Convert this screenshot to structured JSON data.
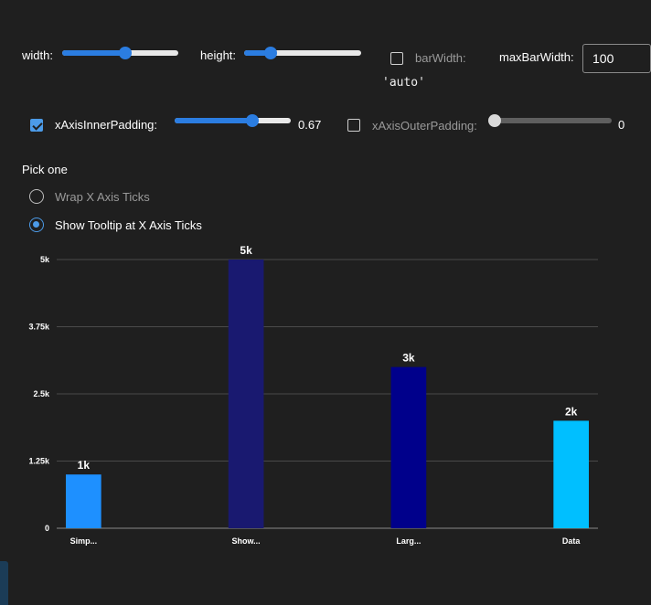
{
  "controls": {
    "width": {
      "label": "width:",
      "fraction": 0.54
    },
    "height": {
      "label": "height:",
      "fraction": 0.23
    },
    "bar_width": {
      "label": "barWidth:",
      "checked": false,
      "value_text": "'auto'"
    },
    "max_bar_width": {
      "label": "maxBarWidth:",
      "value": "100"
    },
    "x_axis_inner_padding": {
      "label": "xAxisInnerPadding:",
      "checked": true,
      "value": 0.67,
      "value_text": "0.67"
    },
    "x_axis_outer_padding": {
      "label": "xAxisOuterPadding:",
      "checked": false,
      "value": 0,
      "value_text": "0"
    }
  },
  "pick": {
    "title": "Pick one",
    "options": [
      {
        "label": "Wrap X Axis Ticks",
        "selected": false
      },
      {
        "label": "Show Tooltip at X Axis Ticks",
        "selected": true
      }
    ]
  },
  "colors": {
    "background": "#1f1f1f",
    "slider_fill": "#2b7de1",
    "checkbox": "#4c9be8",
    "gridline": "#4a4a4a"
  },
  "chart_data": {
    "type": "bar",
    "categories": [
      "Simp...",
      "Show...",
      "Larg...",
      "Data"
    ],
    "values": [
      1000,
      5000,
      3000,
      2000
    ],
    "data_labels": [
      "1k",
      "5k",
      "3k",
      "2k"
    ],
    "bar_colors": [
      "#1e90ff",
      "#191970",
      "#00008b",
      "#00bfff"
    ],
    "yticks": [
      0,
      1250,
      2500,
      3750,
      5000
    ],
    "ytick_labels": [
      "0",
      "1.25k",
      "2.5k",
      "3.75k",
      "5k"
    ],
    "ylim": [
      0,
      5000
    ],
    "grid": true,
    "legend": "none",
    "title": "",
    "xlabel": "",
    "ylabel": ""
  }
}
